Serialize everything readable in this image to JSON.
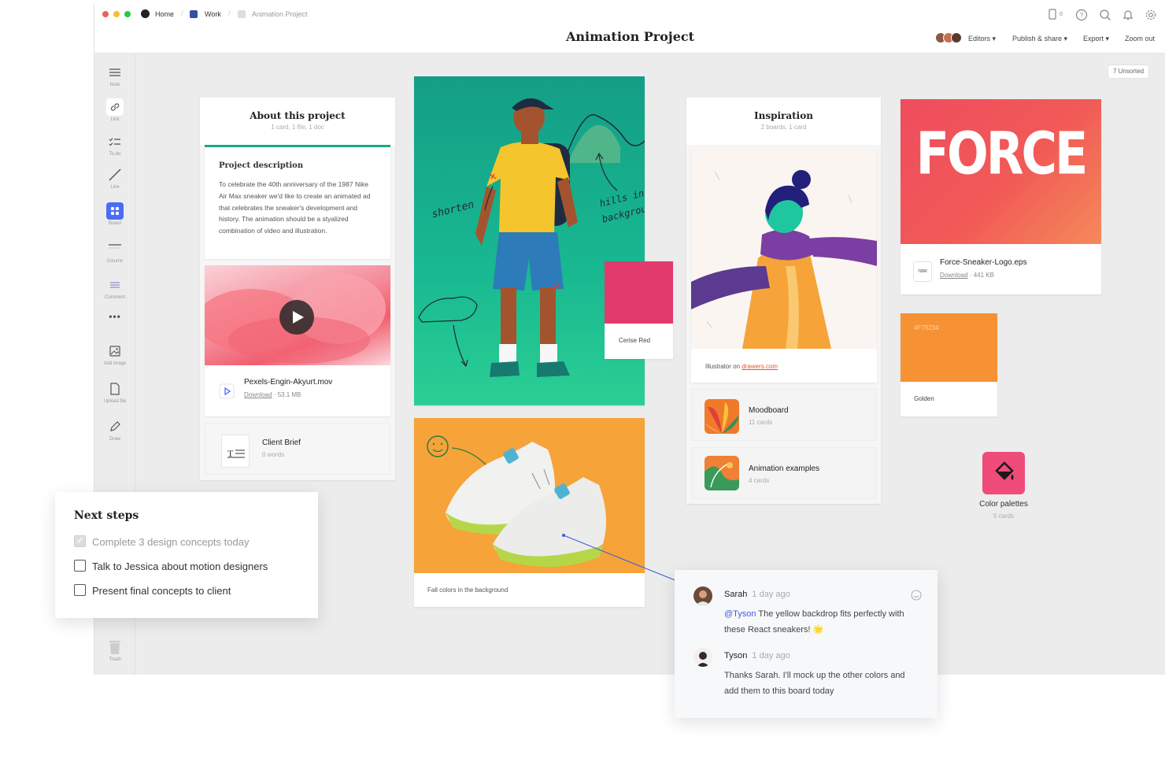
{
  "breadcrumb": {
    "home": "Home",
    "work": "Work",
    "project": "Animation Project"
  },
  "title": "Animation Project",
  "topbar": {
    "device_count": "0",
    "editors": "Editors",
    "publish": "Publish & share",
    "export": "Export",
    "zoom": "Zoom out"
  },
  "unsorted": "7 Unsorted",
  "toolbar": {
    "note": "Note",
    "link": "Link",
    "todo": "To-do",
    "line": "Line",
    "board": "Board",
    "column": "Column",
    "comment": "Comment",
    "add_image": "Add image",
    "upload": "Upload file",
    "draw": "Draw",
    "trash": "Trash"
  },
  "about": {
    "title": "About this project",
    "subtitle": "1 card, 1 file, 1 doc",
    "desc_title": "Project description",
    "desc": "To celebrate the 40th anniversary of the 1987 Nike Air Max sneaker we'd like to create an animated ad that celebrates the sneaker's development and history. The animation should be a styalized combination of video and illustration.",
    "file_name": "Pexels-Engin-Akyurt.mov",
    "file_download": "Download",
    "file_size": "53.1 MB",
    "brief_title": "Client Brief",
    "brief_sub": "0 words"
  },
  "illustration": {
    "annot_shorten": "shorten",
    "annot_hills1": "hills in",
    "annot_hills2": "background"
  },
  "swatches": {
    "cerise": {
      "label": "Cerise Red",
      "color": "#e33a6e"
    },
    "golden": {
      "label": "Golden",
      "hex": "#F79234",
      "color": "#f79234"
    }
  },
  "sneaker_caption": "Fall colors in the background",
  "inspiration": {
    "title": "Inspiration",
    "subtitle": "2 boards, 1 card",
    "credit_prefix": "Illustrator on",
    "credit_link": "drawers.com",
    "boards": [
      {
        "name": "Moodboard",
        "count": "11 cards"
      },
      {
        "name": "Animation examples",
        "count": "4 cards"
      }
    ]
  },
  "force": {
    "logo_text": "FORCE",
    "file_name": "Force-Sneaker-Logo.eps",
    "file_type": "raw",
    "download": "Download",
    "size": "441 KB"
  },
  "palettes": {
    "name": "Color palettes",
    "count": "5 cards"
  },
  "next_steps": {
    "title": "Next steps",
    "items": [
      {
        "text": "Complete 3 design concepts today",
        "done": true
      },
      {
        "text": "Talk to Jessica about motion designers",
        "done": false
      },
      {
        "text": "Present final concepts to client",
        "done": false
      }
    ]
  },
  "comments": [
    {
      "author": "Sarah",
      "time": "1 day ago",
      "mention": "@Tyson",
      "text": "The yellow backdrop fits perfectly with these React sneakers! 🌟"
    },
    {
      "author": "Tyson",
      "time": "1 day ago",
      "text": "Thanks Sarah. I'll mock up the other colors and add them to this board today"
    }
  ],
  "colors": {
    "accent_blue": "#3b5bdb",
    "teal": "#17a98a",
    "orange": "#f5a03a",
    "pink": "#ef4c79",
    "link_red": "#e4572e"
  }
}
